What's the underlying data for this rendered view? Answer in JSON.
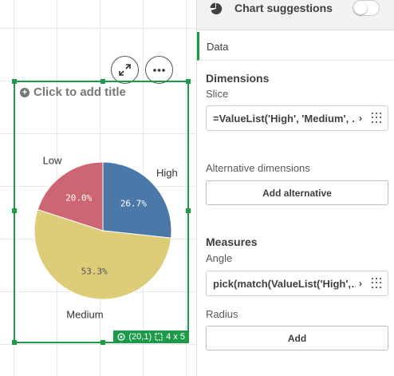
{
  "chart": {
    "title_placeholder": "Click to add title",
    "position_label": "(20,1)",
    "size_label": "4 x 5",
    "expand_icon": "expand-icon",
    "more_icon": "more-options-icon"
  },
  "chart_data": {
    "type": "pie",
    "categories": [
      "High",
      "Medium",
      "Low"
    ],
    "values": [
      26.7,
      53.3,
      20.0
    ],
    "value_labels": [
      "26.7%",
      "53.3%",
      "20.0%"
    ],
    "colors": [
      "#4a78a8",
      "#ddcc78",
      "#cc6673"
    ],
    "title": ""
  },
  "panel": {
    "suggestions_label": "Chart suggestions",
    "data_tab": "Data",
    "dimensions_heading": "Dimensions",
    "slice_label": "Slice",
    "slice_value": "=ValueList('High', 'Medium', …",
    "alt_dimensions_label": "Alternative dimensions",
    "add_alternative_button": "Add alternative",
    "measures_heading": "Measures",
    "angle_label": "Angle",
    "angle_value": "pick(match(ValueList('High',…",
    "radius_label": "Radius",
    "add_button": "Add"
  },
  "colors": {
    "accent": "#1c9a48",
    "text": "#404040"
  }
}
